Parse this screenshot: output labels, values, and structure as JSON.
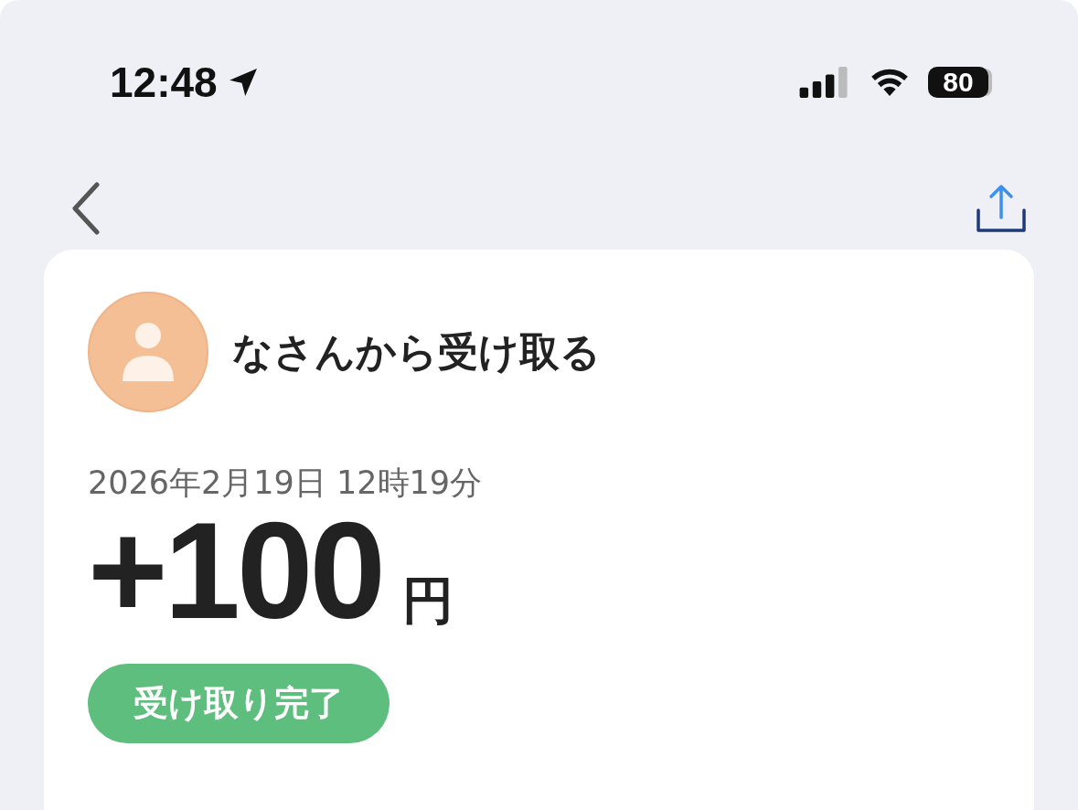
{
  "status_bar": {
    "time": "12:48",
    "battery": "80"
  },
  "detail": {
    "title": "なさんから受け取る",
    "date": "2026年2月19日 12時19分",
    "amount": "+100",
    "currency": "円",
    "status": {
      "label": "受け取り完了",
      "kind": "completed"
    }
  }
}
